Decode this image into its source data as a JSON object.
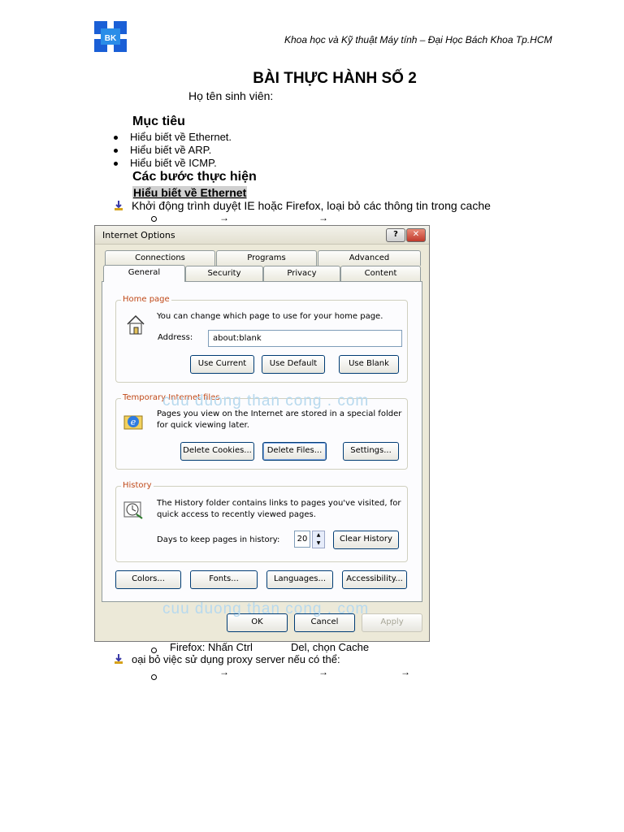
{
  "header": {
    "logo_text": "BK",
    "institution": "Khoa học và Kỹ thuật Máy tính – Đại Học Bách Khoa Tp.HCM"
  },
  "document": {
    "title": "BÀI THỰC HÀNH SỐ 2",
    "student_label": "Họ tên sinh viên:",
    "objectives_heading": "Mục tiêu",
    "objectives": [
      "Hiểu biết về Ethernet.",
      "Hiểu biết về ARP.",
      "Hiểu biết về ICMP."
    ],
    "steps_heading": "Các bước thực hiện",
    "ethernet_heading": "Hiểu biết về Ethernet",
    "step1": "Khởi động trình duyệt IE hoặc Firefox, loại bỏ các thông tin trong cache",
    "firefox_text": "Firefox: Nhấn Ctrl",
    "firefox_text2": "Del, chọn Cache",
    "step2": "oại bỏ việc sử dụng proxy server nếu có thể:",
    "arrow": "→"
  },
  "watermark": "cuu duong than cong . com",
  "dialog": {
    "title": "Internet Options",
    "help_glyph": "?",
    "close_glyph": "✕",
    "tabs_back": [
      "Connections",
      "Programs",
      "Advanced"
    ],
    "tabs_front": [
      "General",
      "Security",
      "Privacy",
      "Content"
    ],
    "home_page": {
      "label": "Home page",
      "description": "You can change which page to use for your home page.",
      "address_label": "Address:",
      "address_value": "about:blank",
      "buttons": [
        "Use Current",
        "Use Default",
        "Use Blank"
      ]
    },
    "temp_files": {
      "label": "Temporary Internet files",
      "description_line1": "Pages you view on the Internet are stored in a special folder",
      "description_line2": "for quick viewing later.",
      "buttons": [
        "Delete Cookies...",
        "Delete Files...",
        "Settings..."
      ]
    },
    "history": {
      "label": "History",
      "description_line1": "The History folder contains links to pages you've visited, for",
      "description_line2": "quick access to recently viewed pages.",
      "days_label": "Days to keep pages in history:",
      "days_value": "20",
      "clear_button": "Clear History"
    },
    "bottom_buttons": [
      "Colors...",
      "Fonts...",
      "Languages...",
      "Accessibility..."
    ],
    "footer_buttons": [
      "OK",
      "Cancel",
      "Apply"
    ]
  }
}
